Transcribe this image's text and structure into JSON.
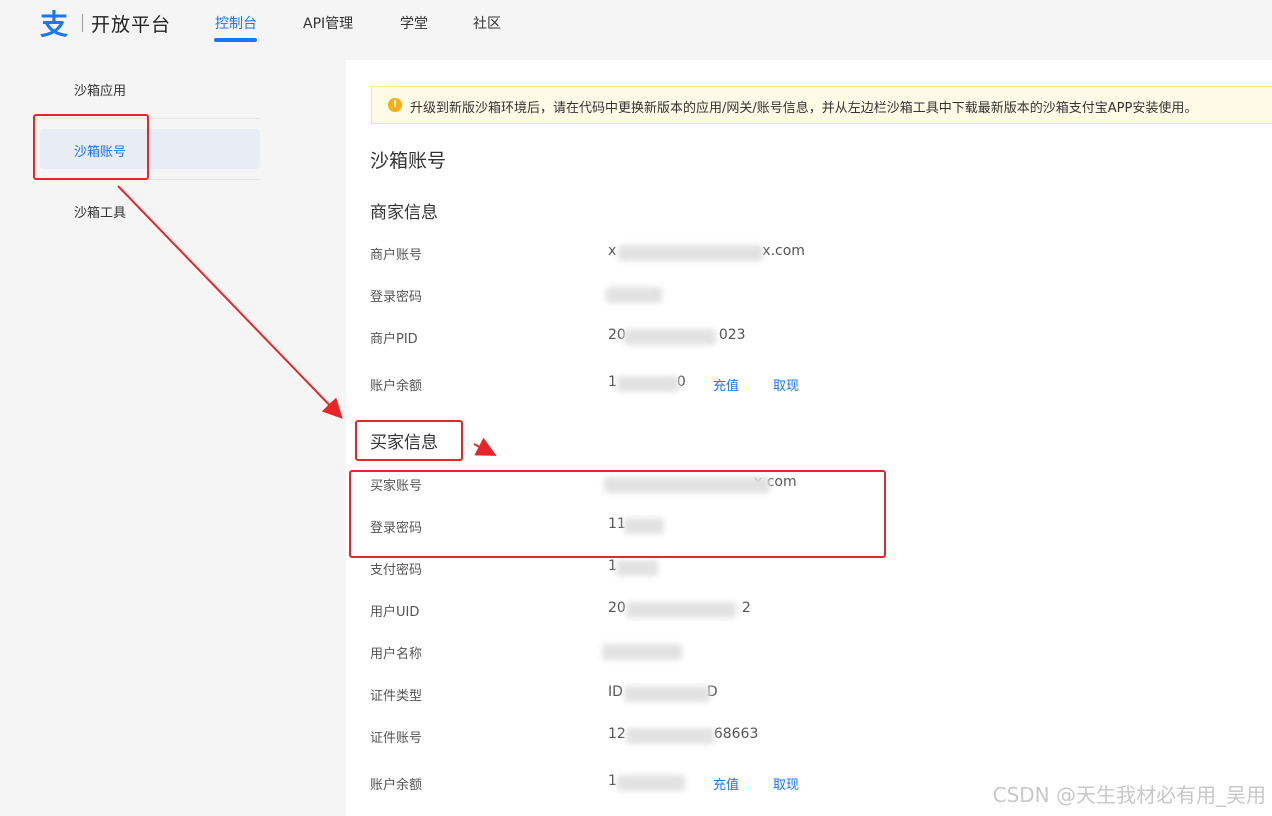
{
  "nav": {
    "brand": "开放平台",
    "items": [
      {
        "label": "控制台"
      },
      {
        "label": "API管理"
      },
      {
        "label": "学堂"
      },
      {
        "label": "社区"
      }
    ]
  },
  "sidebar": {
    "items": [
      {
        "label": "沙箱应用"
      },
      {
        "label": "沙箱账号"
      },
      {
        "label": "沙箱工具"
      }
    ]
  },
  "notice": {
    "icon": "warning-icon",
    "text": "升级到新版沙箱环境后，请在代码中更换新版本的应用/网关/账号信息，并从左边栏沙箱工具中下载最新版本的沙箱支付宝APP安装使用。"
  },
  "page_title": "沙箱账号",
  "merchant": {
    "title": "商家信息",
    "rows": [
      {
        "label": "商户账号",
        "value": "x",
        "suffix": "x.com"
      },
      {
        "label": "登录密码",
        "value": "",
        "suffix": ""
      },
      {
        "label": "商户PID",
        "value": "20",
        "suffix": "023"
      },
      {
        "label": "账户余额",
        "value": "1",
        "suffix": "0"
      }
    ],
    "recharge": "充值",
    "withdraw": "取现"
  },
  "buyer": {
    "title": "买家信息",
    "rows": [
      {
        "label": "买家账号",
        "value": "",
        "suffix": "x.com"
      },
      {
        "label": "登录密码",
        "value": "11",
        "suffix": ""
      },
      {
        "label": "支付密码",
        "value": "1",
        "suffix": ""
      },
      {
        "label": "用户UID",
        "value": "20",
        "suffix": "2"
      },
      {
        "label": "用户名称",
        "value": "",
        "suffix": ""
      },
      {
        "label": "证件类型",
        "value": "ID",
        "suffix": "D"
      },
      {
        "label": "证件账号",
        "value": "12",
        "suffix": "68663"
      },
      {
        "label": "账户余额",
        "value": "1",
        "suffix": ""
      }
    ],
    "recharge": "充值",
    "withdraw": "取现"
  },
  "watermark": "CSDN @天生我材必有用_吴用",
  "colors": {
    "accent": "#1677ff",
    "annotation": "#e8262a",
    "notice_bg": "#fffbe6"
  }
}
